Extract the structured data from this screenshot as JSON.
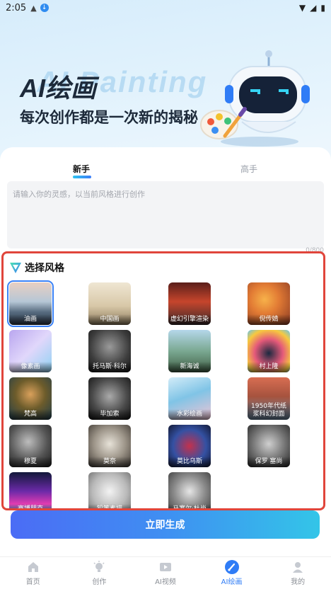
{
  "status_bar": {
    "time": "2:05"
  },
  "banner": {
    "bg_text": "AI Painting",
    "title": "AI绘画",
    "subtitle": "每次创作都是一次新的揭秘"
  },
  "tabs": [
    {
      "label": "新手"
    },
    {
      "label": "高手"
    }
  ],
  "prompt": {
    "placeholder": "请输入你的灵感，以当前风格进行创作",
    "counter": "0/800"
  },
  "styles": {
    "title": "选择风格",
    "items": [
      {
        "label": "油画",
        "icon": "oil-painting-art"
      },
      {
        "label": "中国画",
        "icon": "chinese-painting-art"
      },
      {
        "label": "虚幻引擎渲染",
        "icon": "unreal-engine-art"
      },
      {
        "label": "倪传婧",
        "icon": "ni-chuanjing-art"
      },
      {
        "label": "像素画",
        "icon": "pixel-art"
      },
      {
        "label": "托马斯·科尔",
        "icon": "thomas-cole-art"
      },
      {
        "label": "新海诚",
        "icon": "makoto-shinkai-art"
      },
      {
        "label": "村上隆",
        "icon": "murakami-art"
      },
      {
        "label": "梵高",
        "icon": "van-gogh-art"
      },
      {
        "label": "毕加索",
        "icon": "picasso-art"
      },
      {
        "label": "水彩绘画",
        "icon": "watercolor-art"
      },
      {
        "label": "1950年代纸浆科幻封面",
        "icon": "pulp-scifi-art"
      },
      {
        "label": "穆夏",
        "icon": "mucha-art"
      },
      {
        "label": "莫奈",
        "icon": "monet-art"
      },
      {
        "label": "莫比乌斯",
        "icon": "moebius-art"
      },
      {
        "label": "保罗 塞尚",
        "icon": "cezanne-art"
      },
      {
        "label": "赛博朋克",
        "icon": "cyberpunk-art"
      },
      {
        "label": "铅笔素描",
        "icon": "pencil-sketch-art"
      },
      {
        "label": "马塞尔·杜尚",
        "icon": "duchamp-art"
      }
    ]
  },
  "generate_button": {
    "label": "立即生成"
  },
  "bottom_nav": [
    {
      "label": "首页",
      "icon": "home-icon"
    },
    {
      "label": "创作",
      "icon": "bulb-icon"
    },
    {
      "label": "AI视频",
      "icon": "video-icon"
    },
    {
      "label": "AI绘画",
      "icon": "brush-icon"
    },
    {
      "label": "我的",
      "icon": "user-icon"
    }
  ],
  "colors": {
    "accent": "#2f7cf6",
    "highlight_border": "#e0453b",
    "button_start": "#4b6cf5",
    "button_end": "#33c5e8"
  }
}
